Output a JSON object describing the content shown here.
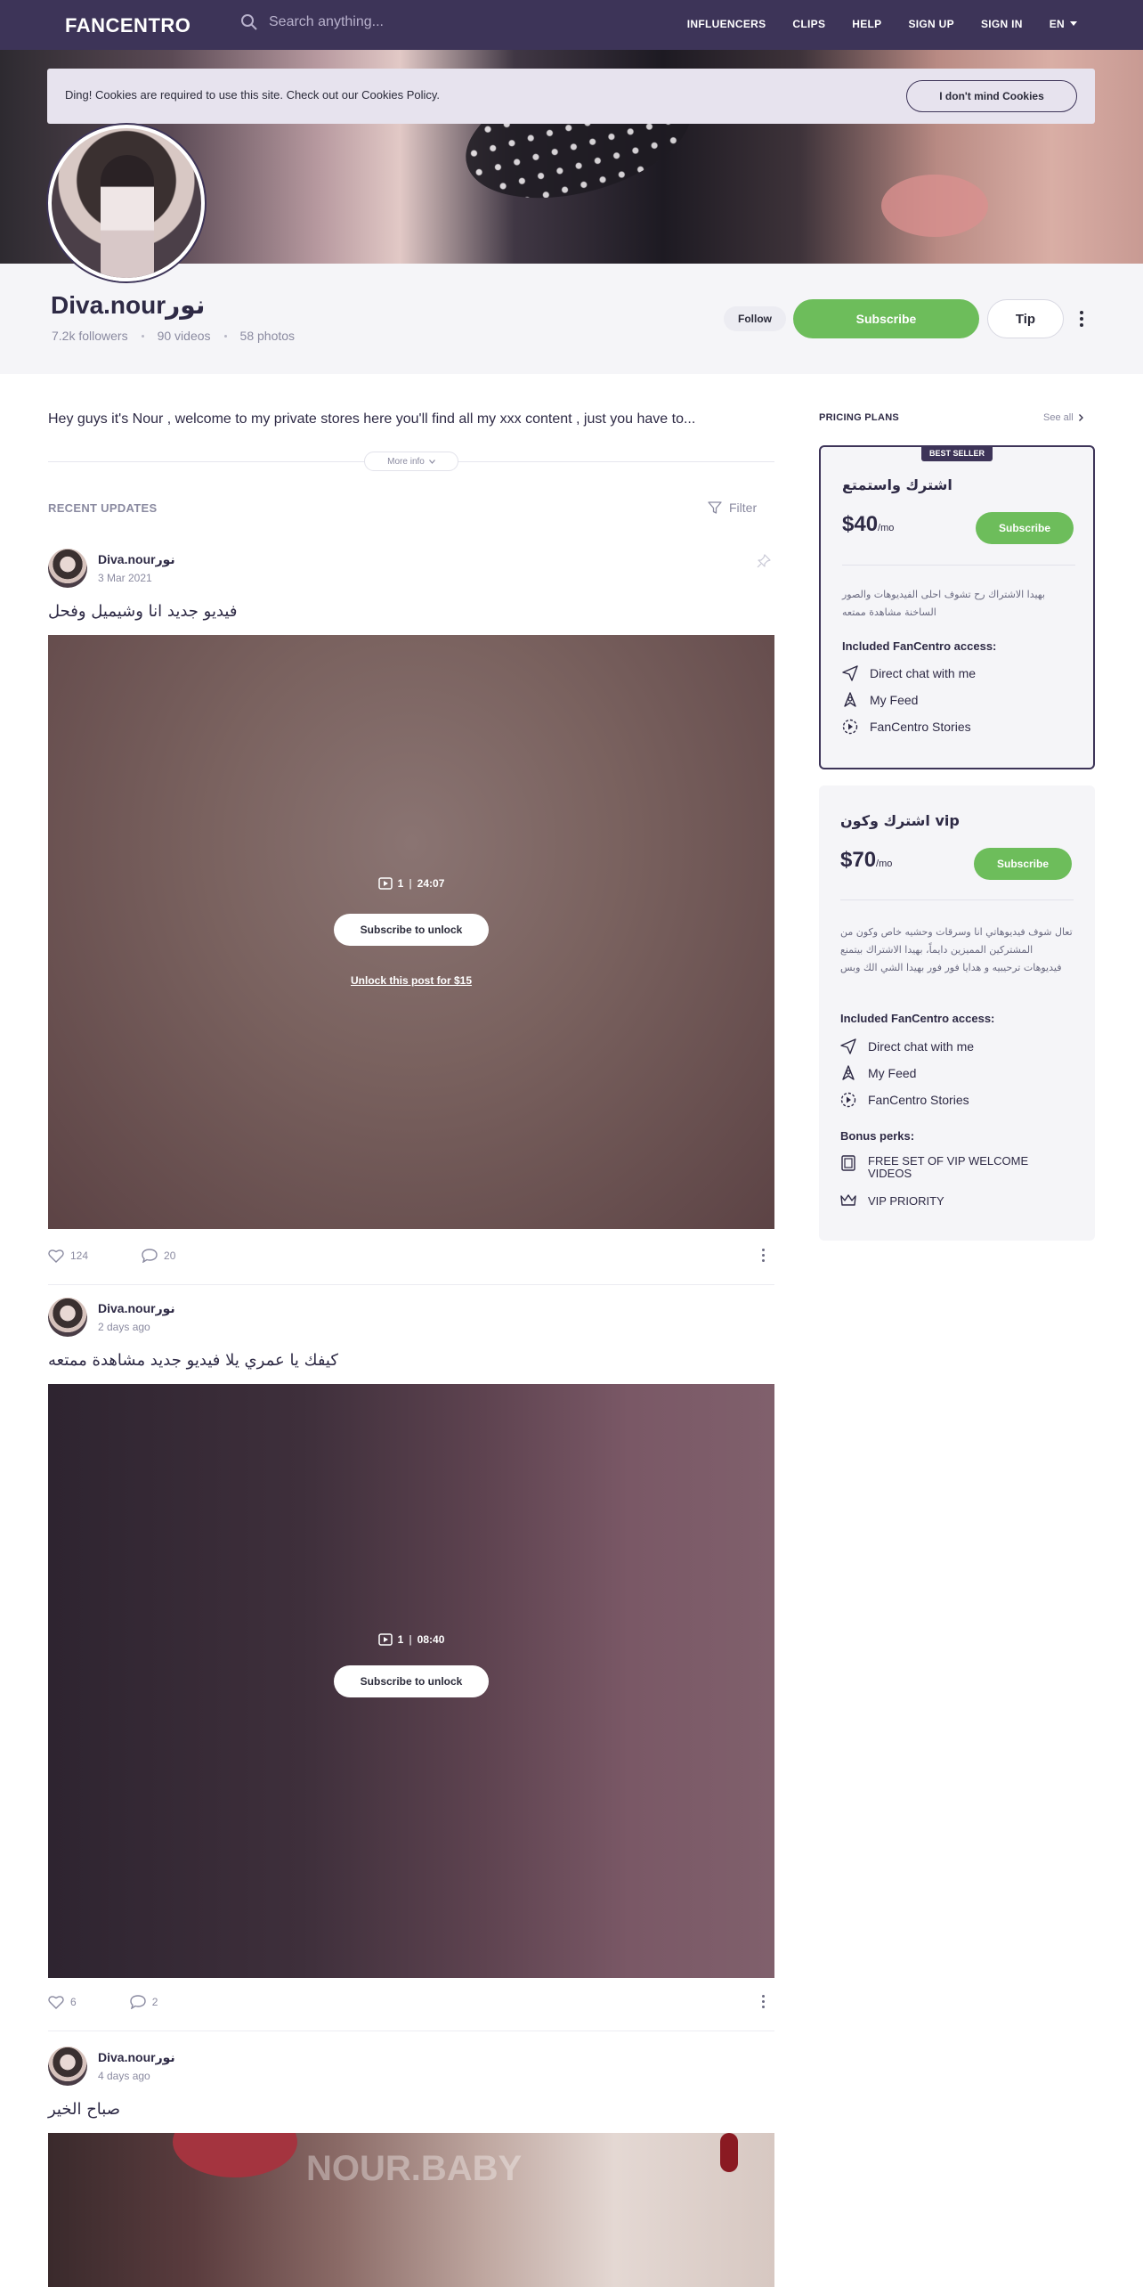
{
  "header": {
    "logo": "FANCENTRO",
    "search_placeholder": "Search anything...",
    "nav": [
      "INFLUENCERS",
      "CLIPS",
      "HELP",
      "SIGN UP",
      "SIGN IN"
    ],
    "lang": "EN"
  },
  "cookie": {
    "message": "Ding! Cookies are required to use this site. Check out our Cookies Policy.",
    "button": "I don't mind Cookies"
  },
  "profile": {
    "name": "Diva.nourنور",
    "followers": "7.2k followers",
    "videos": "90 videos",
    "photos": "58 photos",
    "follow": "Follow",
    "subscribe": "Subscribe",
    "tip": "Tip"
  },
  "bio": {
    "text": "Hey guys it's Nour , welcome to my private stores here you'll find all my xxx content , just you have to...",
    "more": "More info"
  },
  "feed": {
    "title": "RECENT UPDATES",
    "filter": "Filter",
    "posts": [
      {
        "author": "Diva.nourنور",
        "date": "3 Mar 2021",
        "caption": "فيديو جديد انا وشيميل وفحل",
        "duration_count": "1",
        "duration": "24:07",
        "unlock": "Subscribe to unlock",
        "unlock_pay": "Unlock this post for $15",
        "likes": "124",
        "comments": "20"
      },
      {
        "author": "Diva.nourنور",
        "date": "2 days ago",
        "caption": "كيفك يا عمري يلا فيديو جديد مشاهدة ممتعه",
        "duration_count": "1",
        "duration": "08:40",
        "unlock": "Subscribe to unlock",
        "likes": "6",
        "comments": "2"
      },
      {
        "author": "Diva.nourنور",
        "date": "4 days ago",
        "caption": "صباح الخير",
        "watermark": "NOUR.BABY"
      }
    ]
  },
  "pricing": {
    "heading": "PRICING PLANS",
    "see_all": "See all",
    "plans": [
      {
        "tag": "BEST SELLER",
        "title": "اشترك واستمتع",
        "price": "$40",
        "per": "/mo",
        "subscribe": "Subscribe",
        "description": "بهيدا الاشتراك رح تشوف احلى الفيديوهات والصور الساخنة مشاهدة ممتعه",
        "included_label": "Included FanCentro access:",
        "features": [
          "Direct chat with me",
          "My Feed",
          "FanCentro Stories"
        ]
      },
      {
        "title": "اشترك وكون vip",
        "price": "$70",
        "per": "/mo",
        "subscribe": "Subscribe",
        "description": "تعال شوف فيديوهاتي انا وسرقات وحشيه خاص وكون من المشتركين المميزين دايماً، بهيدا الاشتراك بيتمنع فيديوهات ترحيبيه و هدايا فور فور بهيدا الشي الك وبس",
        "included_label": "Included FanCentro access:",
        "features": [
          "Direct chat with me",
          "My Feed",
          "FanCentro Stories"
        ],
        "bonus_label": "Bonus perks:",
        "bonus": [
          "FREE SET OF VIP WELCOME VIDEOS",
          "VIP PRIORITY"
        ]
      }
    ]
  },
  "colors": {
    "header_bg": "#3d3458",
    "accent_green": "#6dbd5b",
    "panel_bg": "#f5f5f8"
  }
}
